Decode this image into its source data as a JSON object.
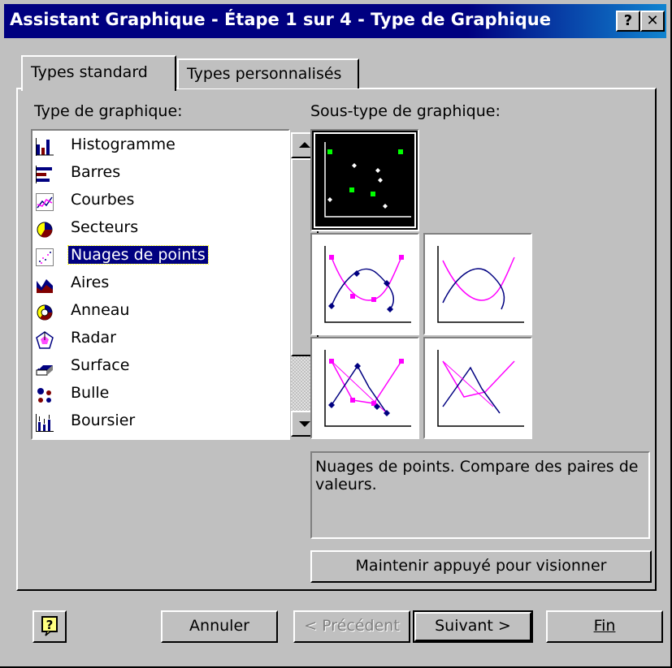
{
  "window": {
    "title": "Assistant Graphique - Étape 1 sur 4 - Type de Graphique",
    "help_glyph": "?",
    "close_glyph": "✕"
  },
  "tabs": [
    {
      "label": "Types standard",
      "active": true
    },
    {
      "label": "Types personnalisés",
      "active": false
    }
  ],
  "chart_type": {
    "label": "Type de graphique:",
    "items": [
      {
        "label": "Histogramme",
        "icon": "column-chart-icon"
      },
      {
        "label": "Barres",
        "icon": "bar-chart-icon"
      },
      {
        "label": "Courbes",
        "icon": "line-chart-icon"
      },
      {
        "label": "Secteurs",
        "icon": "pie-chart-icon"
      },
      {
        "label": "Nuages de points",
        "icon": "scatter-chart-icon",
        "selected": true
      },
      {
        "label": "Aires",
        "icon": "area-chart-icon"
      },
      {
        "label": "Anneau",
        "icon": "doughnut-chart-icon"
      },
      {
        "label": "Radar",
        "icon": "radar-chart-icon"
      },
      {
        "label": "Surface",
        "icon": "surface-chart-icon"
      },
      {
        "label": "Bulle",
        "icon": "bubble-chart-icon"
      },
      {
        "label": "Boursier",
        "icon": "stock-chart-icon"
      }
    ]
  },
  "subtype": {
    "label": "Sous-type de graphique:",
    "selected_index": 0,
    "tiles": [
      "scatter-markers-only-icon",
      "scatter-smoothed-lines-markers-icon",
      "scatter-smoothed-lines-icon",
      "scatter-lines-markers-icon",
      "scatter-lines-icon"
    ]
  },
  "description": "Nuages de points. Compare des paires de valeurs.",
  "preview_button": "Maintenir appuyé pour visionner",
  "footer": {
    "help_glyph": "?",
    "cancel": "Annuler",
    "previous": "< Précédent",
    "next": "Suivant >",
    "finish": "Fin"
  },
  "colors": {
    "title_bar": "#000080",
    "selection": "#000080",
    "face": "#c0c0c0",
    "series_a": "#ff00ff",
    "series_b": "#000080",
    "markers_green": "#00ff00"
  }
}
